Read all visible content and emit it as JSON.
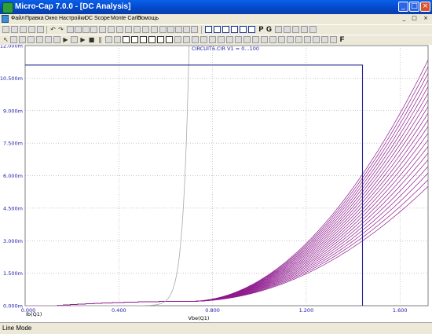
{
  "window": {
    "title": "Micro-Cap 7.0.0 - [DC Analysis]",
    "minimize": "_",
    "maximize": "□",
    "close": "×"
  },
  "menu": {
    "items": [
      "Файл",
      "Правка",
      "Окно",
      "Настройки",
      "DC",
      "Scope",
      "Monte Carlo",
      "Помощь"
    ],
    "mdi_buttons": "_ □ ×"
  },
  "toolbar": {
    "letter_buttons": [
      "P",
      "G",
      "F"
    ]
  },
  "status": {
    "mode": "Line Mode"
  },
  "colors": {
    "curve_family": "#8e1a8e",
    "reference_curve": "#a8a8a8",
    "limit_box": "#23238e",
    "axis_text": "#1a1aa8",
    "grid": "#909090"
  },
  "chart_data": {
    "type": "line",
    "title": "CIRCUIT6.CIR V1 = 0...100",
    "xlabel": "Vbe(Q1)",
    "ylabel": "Ib(Q1)",
    "xlim": [
      0,
      1.72
    ],
    "ylim": [
      0,
      0.012
    ],
    "x_ticks": [
      "0.000",
      "0.400",
      "0.800",
      "1.200",
      "1.600"
    ],
    "y_ticks": [
      "0.000m",
      "1.500m",
      "3.000m",
      "4.500m",
      "6.000m",
      "7.500m",
      "9.000m",
      "10.500m",
      "12.000m"
    ],
    "grid": true,
    "reference_curve": {
      "name": "",
      "vt": 0.025,
      "threshold": 0.58,
      "scale": 0.0001
    },
    "family": {
      "parameter": "V1",
      "range": [
        0,
        100
      ],
      "count": 20,
      "knee_x": 0.7,
      "knee_y": 0.0002,
      "toe_slope": 0.002,
      "min_rise": 0.0107,
      "max_rise": 0.0051,
      "exponent": 2
    },
    "limit_box": {
      "x": [
        0,
        1.44,
        1.44
      ],
      "y": [
        0.0111,
        0.0111,
        0
      ]
    }
  }
}
